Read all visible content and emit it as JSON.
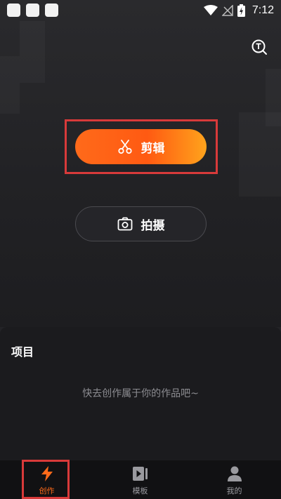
{
  "status_bar": {
    "time": "7:12",
    "icons": [
      "notification-square-icon",
      "notification-square-icon",
      "notification-square-icon",
      "wifi-icon",
      "no-signal-icon",
      "battery-charging-icon"
    ]
  },
  "header": {
    "template_icon": "search-t-icon"
  },
  "main": {
    "edit_button": {
      "label": "剪辑",
      "icon": "scissors-icon"
    },
    "shoot_button": {
      "label": "拍摄",
      "icon": "camera-icon"
    }
  },
  "projects": {
    "title": "项目",
    "empty_text": "快去创作属于你的作品吧~"
  },
  "tabbar": {
    "tabs": [
      {
        "label": "创作",
        "icon": "lightning-icon",
        "active": true
      },
      {
        "label": "模板",
        "icon": "video-template-icon",
        "active": false
      },
      {
        "label": "我的",
        "icon": "user-icon",
        "active": false
      }
    ]
  },
  "colors": {
    "accent": "#ff6a1a",
    "highlight": "#d83a3a",
    "background": "#232327"
  }
}
